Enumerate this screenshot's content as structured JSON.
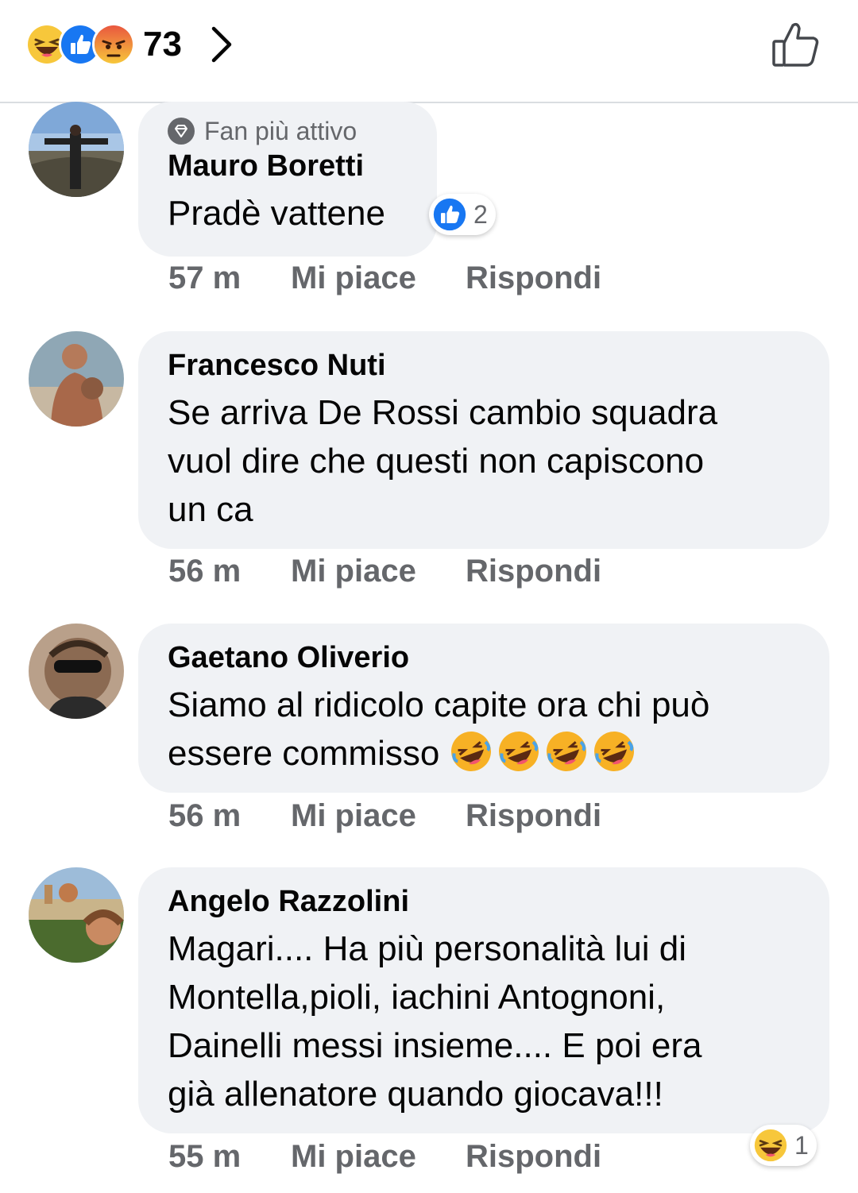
{
  "header": {
    "reaction_count": "73",
    "reactions": [
      "haha-icon",
      "like-icon",
      "angry-icon"
    ]
  },
  "comments": [
    {
      "badge": "Fan più attivo",
      "author": "Mauro Boretti",
      "text": "Pradè vattene",
      "time": "57 m",
      "like_label": "Mi piace",
      "reply_label": "Rispondi",
      "reaction": {
        "icon": "like-icon",
        "count": "2"
      }
    },
    {
      "author": "Francesco Nuti",
      "text_lines": [
        "Se arriva De Rossi cambio squadra",
        "vuol dire che questi non capiscono",
        "un ca"
      ],
      "time": "56 m",
      "like_label": "Mi piace",
      "reply_label": "Rispondi"
    },
    {
      "author": "Gaetano Oliverio",
      "text_lines": [
        "Siamo al ridicolo capite ora chi può",
        "essere commisso"
      ],
      "emojis": [
        "rofl-icon",
        "rofl-icon",
        "rofl-icon",
        "rofl-icon"
      ],
      "time": "56 m",
      "like_label": "Mi piace",
      "reply_label": "Rispondi"
    },
    {
      "author": "Angelo Razzolini",
      "text_lines": [
        "Magari.... Ha più personalità lui di",
        "Montella,pioli, iachini Antognoni,",
        "Dainelli messi insieme.... E poi era",
        "già allenatore quando giocava!!!"
      ],
      "time": "55 m",
      "like_label": "Mi piace",
      "reply_label": "Rispondi",
      "reaction": {
        "icon": "haha-icon",
        "count": "1"
      }
    }
  ],
  "colors": {
    "bubble": "#f0f2f5",
    "meta_text": "#65676b",
    "like_blue": "#1877f2",
    "haha_yellow": "#f7b125"
  }
}
